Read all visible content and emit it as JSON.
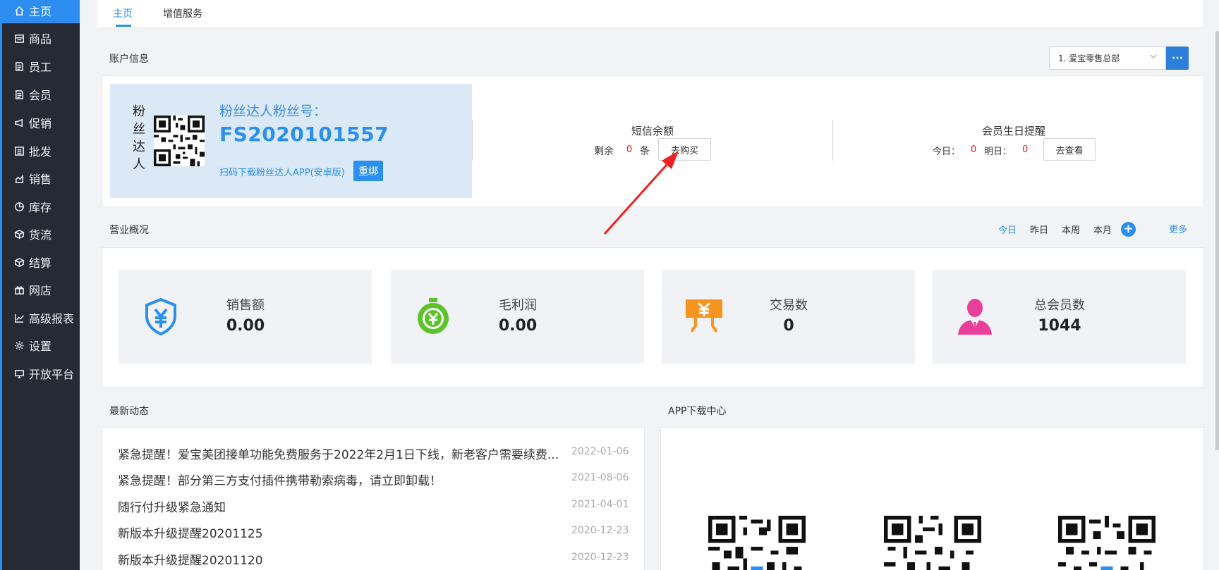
{
  "sidebar": {
    "items": [
      {
        "label": "主页",
        "icon": "home-icon"
      },
      {
        "label": "商品",
        "icon": "store-icon"
      },
      {
        "label": "员工",
        "icon": "document-icon"
      },
      {
        "label": "会员",
        "icon": "document-icon"
      },
      {
        "label": "促销",
        "icon": "megaphone-icon"
      },
      {
        "label": "批发",
        "icon": "list-icon"
      },
      {
        "label": "销售",
        "icon": "bar-chart-icon"
      },
      {
        "label": "库存",
        "icon": "pie-chart-icon"
      },
      {
        "label": "货流",
        "icon": "cube-icon"
      },
      {
        "label": "结算",
        "icon": "cube-icon"
      },
      {
        "label": "网店",
        "icon": "gift-icon"
      },
      {
        "label": "高级报表",
        "icon": "line-chart-icon"
      },
      {
        "label": "设置",
        "icon": "gear-icon"
      },
      {
        "label": "开放平台",
        "icon": "monitor-icon"
      }
    ]
  },
  "tabs": [
    {
      "label": "主页"
    },
    {
      "label": "增值服务"
    }
  ],
  "account": {
    "section_title": "账户信息",
    "store_select_value": "1. 爱宝零售总部",
    "store_more_label": "···",
    "brand_vertical": [
      "粉",
      "丝",
      "达",
      "人"
    ],
    "fan_label": "粉丝达人粉丝号：",
    "fan_number": "FS2020101557",
    "scan_text": "扫码下载粉丝达人APP(安卓版)",
    "rebind_label": "重绑",
    "sms": {
      "title": "短信余额",
      "remain_label": "剩余",
      "remain_value": "0",
      "unit": "条",
      "buy_label": "去购买"
    },
    "birthday": {
      "title": "会员生日提醒",
      "today_label": "今日：",
      "today_value": "0",
      "tomorrow_label": "明日：",
      "tomorrow_value": "0",
      "view_label": "去查看"
    }
  },
  "business": {
    "section_title": "营业概况",
    "periods": [
      "今日",
      "昨日",
      "本周",
      "本月"
    ],
    "active_period": "今日",
    "add_label": "+",
    "more_label": "更多",
    "cards": [
      {
        "label": "销售额",
        "value": "0.00",
        "icon": "shield-yen-icon",
        "color": "#2b8ff0"
      },
      {
        "label": "毛利润",
        "value": "0.00",
        "icon": "stopwatch-yen-icon",
        "color": "#5cc42a"
      },
      {
        "label": "交易数",
        "value": "0",
        "icon": "yen-sign-icon",
        "color": "#f7941d"
      },
      {
        "label": "总会员数",
        "value": "1044",
        "icon": "member-icon",
        "color": "#e8409a"
      }
    ]
  },
  "news": {
    "section_title": "最新动态",
    "items": [
      {
        "title": "紧急提醒！爱宝美团接单功能免费服务于2022年2月1日下线，新老客户需要续费...",
        "date": "2022-01-06"
      },
      {
        "title": "紧急提醒！部分第三方支付插件携带勒索病毒，请立即卸载！",
        "date": "2021-08-06"
      },
      {
        "title": "随行付升级紧急通知",
        "date": "2021-04-01"
      },
      {
        "title": "新版本升级提醒20201125",
        "date": "2020-12-23"
      },
      {
        "title": "新版本升级提醒20201120",
        "date": "2020-12-23"
      }
    ]
  },
  "app_center": {
    "section_title": "APP下载中心"
  }
}
